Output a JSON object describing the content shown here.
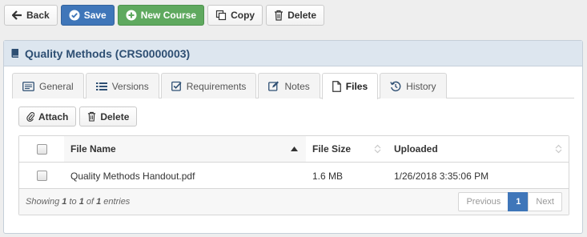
{
  "toolbar": {
    "back_label": "Back",
    "save_label": "Save",
    "new_course_label": "New Course",
    "copy_label": "Copy",
    "delete_label": "Delete"
  },
  "panel": {
    "title": "Quality Methods (CRS0000003)"
  },
  "tabs": [
    {
      "label": "General"
    },
    {
      "label": "Versions"
    },
    {
      "label": "Requirements"
    },
    {
      "label": "Notes"
    },
    {
      "label": "Files"
    },
    {
      "label": "History"
    }
  ],
  "files": {
    "attach_label": "Attach",
    "delete_label": "Delete",
    "columns": {
      "name": "File Name",
      "size": "File Size",
      "uploaded": "Uploaded"
    },
    "rows": [
      {
        "name": "Quality Methods Handout.pdf",
        "size": "1.6 MB",
        "uploaded": "1/26/2018 3:35:06 PM"
      }
    ],
    "info": {
      "prefix": "Showing ",
      "start": "1",
      "to": " to ",
      "end": "1",
      "of": " of ",
      "total": "1",
      "suffix": " entries"
    },
    "pager": {
      "previous": "Previous",
      "current": "1",
      "next": "Next"
    }
  },
  "colors": {
    "primary": "#3f76b9",
    "success": "#5fa95f",
    "panel_header": "#dde6ef"
  }
}
